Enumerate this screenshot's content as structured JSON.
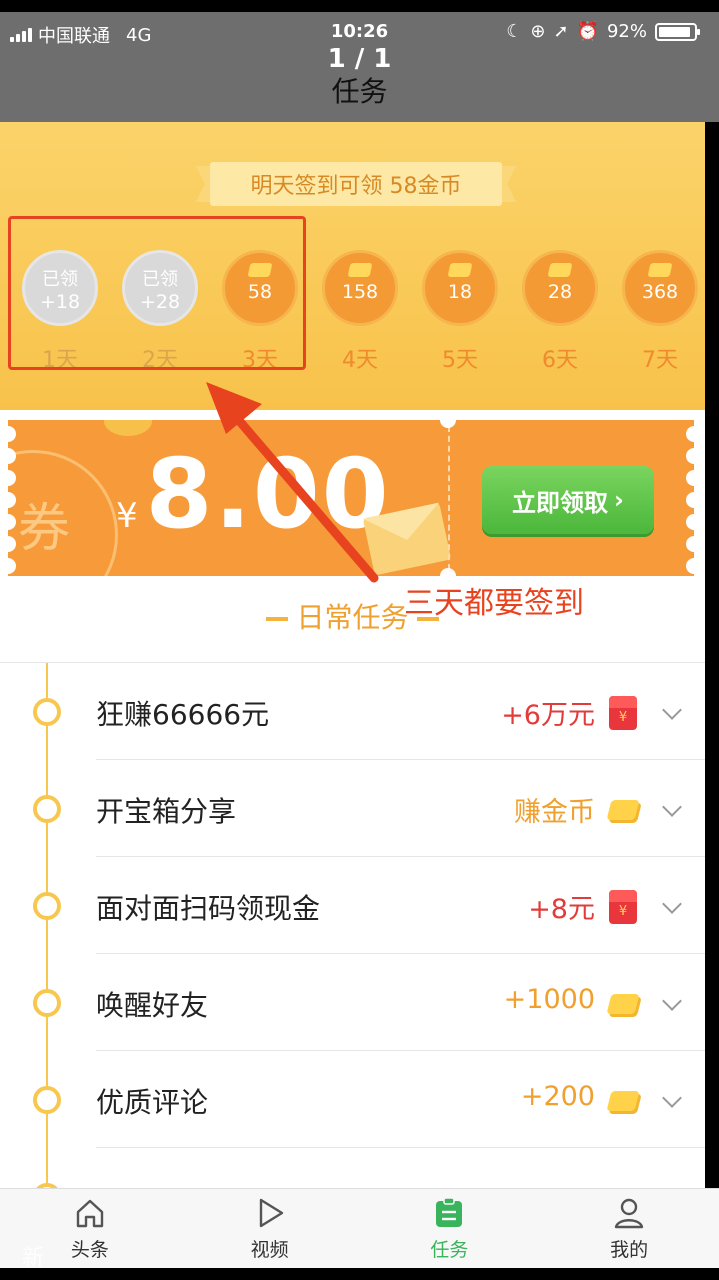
{
  "status_bar": {
    "carrier": "中国联通",
    "network": "4G",
    "time": "10:26",
    "battery": "92%",
    "battery_level": 0.92
  },
  "nav": {
    "pager": "1 / 1",
    "title": "任务"
  },
  "checkin": {
    "banner": "明天签到可领 58金币",
    "days": [
      {
        "label": "1天",
        "claimed_label": "已领",
        "points": "+18",
        "claimed": true
      },
      {
        "label": "2天",
        "claimed_label": "已领",
        "points": "+28",
        "claimed": true
      },
      {
        "label": "3天",
        "points": "58",
        "claimed": false
      },
      {
        "label": "4天",
        "points": "158",
        "claimed": false
      },
      {
        "label": "5天",
        "points": "18",
        "claimed": false
      },
      {
        "label": "6天",
        "points": "28",
        "claimed": false
      },
      {
        "label": "7天",
        "points": "368",
        "claimed": false
      }
    ]
  },
  "coupon": {
    "stamp": "券",
    "currency": "¥",
    "amount": "8.00",
    "claim_button": "立即领取"
  },
  "annotation": "三天都要签到",
  "daily": {
    "title": "日常任务",
    "tasks": [
      {
        "name": "狂赚66666元",
        "reward": "+6万元",
        "reward_icon": "red-envelope-icon",
        "reward_color": "#e23b3b"
      },
      {
        "name": "开宝箱分享",
        "reward": "赚金币",
        "reward_icon": "gold-ingot-icon",
        "reward_color": "#f0a02e"
      },
      {
        "name": "面对面扫码领现金",
        "reward": "+8元",
        "reward_icon": "red-envelope-icon",
        "reward_color": "#e23b3b"
      },
      {
        "name": "唤醒好友",
        "reward": "+1000",
        "reward_icon": "gold-ingot-icon",
        "reward_color": "#f0a02e"
      },
      {
        "name": "优质评论",
        "reward": "+200",
        "reward_icon": "gold-ingot-icon",
        "reward_color": "#f0a02e"
      }
    ]
  },
  "tab_bar": {
    "tabs": [
      {
        "label": "头条",
        "icon": "home-icon"
      },
      {
        "label": "视频",
        "icon": "play-icon"
      },
      {
        "label": "任务",
        "icon": "task-icon",
        "active": true
      },
      {
        "label": "我的",
        "icon": "person-icon"
      }
    ]
  },
  "watermark": "新"
}
